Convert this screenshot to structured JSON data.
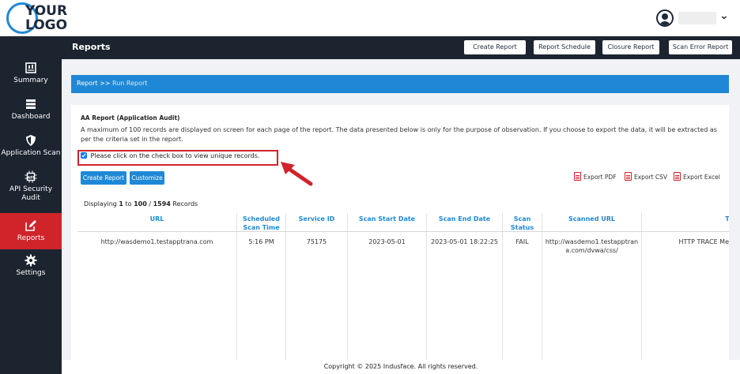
{
  "logo": {
    "line1": "YOUR",
    "line2": "LOGO"
  },
  "sidebar": {
    "items": [
      {
        "label": "Summary",
        "icon": "summary-icon"
      },
      {
        "label": "Dashboard",
        "icon": "dashboard-icon"
      },
      {
        "label": "Application Scan",
        "icon": "shield-icon"
      },
      {
        "label": "API Security Audit",
        "icon": "api-icon"
      },
      {
        "label": "Reports",
        "icon": "edit-icon",
        "active": true
      },
      {
        "label": "Settings",
        "icon": "gear-icon"
      }
    ]
  },
  "header": {
    "title": "Reports",
    "buttons": [
      "Create Report",
      "Report Schedule",
      "Closure Report",
      "Scan Error Report"
    ]
  },
  "breadcrumb": {
    "root": "Report",
    "sep": ">>",
    "current": "Run Report"
  },
  "report": {
    "title": "AA Report (Application Audit)",
    "description": "A maximum of 100 records are displayed on screen for each page of the report. The data presented below is only for the purpose of observation. If you choose to export the data, it will be extracted as per the criteria set in the report.",
    "checkbox_label": "Please click on the check box to view unique records.",
    "checkbox_checked": true,
    "create_button": "Create Report",
    "customize_button": "Customize",
    "export_pdf": "Export PDF",
    "export_csv": "Export CSV",
    "export_excel": "Export Excel",
    "count_prefix": "Displaying ",
    "count_from": "1",
    "count_to_word": " to ",
    "count_to": "100",
    "count_sep": " / ",
    "count_total": "1594",
    "count_suffix": " Records"
  },
  "table": {
    "columns": [
      "URL",
      "Scheduled Scan Time",
      "Service ID",
      "Scan Start Date",
      "Scan End Date",
      "Scan Status",
      "Scanned URL",
      "Titl"
    ],
    "rows": [
      [
        "http://wasdemo1.testapptrana.com",
        "5:16 PM",
        "75175",
        "2023-05-01",
        "2023-05-01 18:22:25",
        "FAIL",
        "http://wasdemo1.testapptrana.com/dvwa/css/",
        "HTTP TRACE Me"
      ]
    ]
  },
  "footer": {
    "text": "Copyright © 2025 Indusface. All rights reserved."
  },
  "colors": {
    "accent": "#1f88d6",
    "sidebar": "#1c2430",
    "active": "#d0242b"
  }
}
